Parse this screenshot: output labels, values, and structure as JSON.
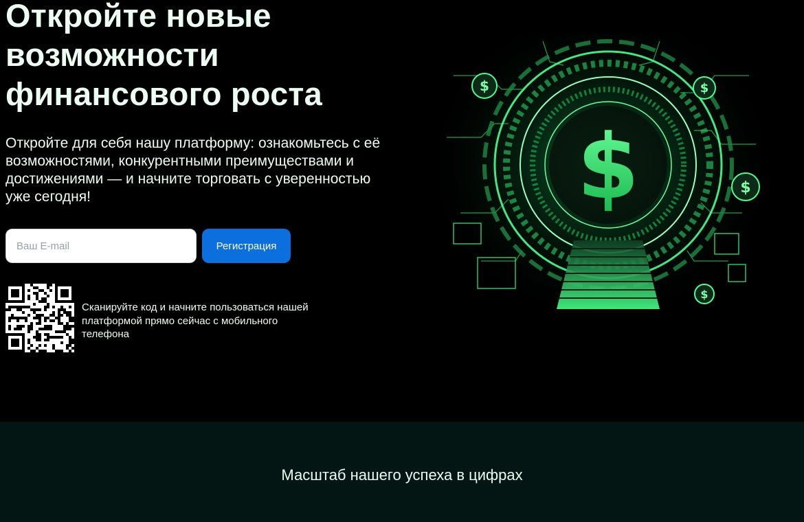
{
  "hero": {
    "headline": "Откройте новые возможности финансового роста",
    "subtitle": "Откройте для себя нашу платформу: ознакомьтесь с её возможностями, конкурентными преимуществами и достижениями — и начните торговать с уверенностью уже сегодня!",
    "email_placeholder": "Ваш E-mail",
    "register_label": "Регистрация",
    "qr_caption": "Сканируйте код и начните пользоваться нашей платформой прямо сейчас с мобильного телефона",
    "accent_color": "#0c6fde",
    "art_icon": "dollar-portal-icon"
  },
  "stats": {
    "title": "Масштаб нашего успеха в цифрах"
  }
}
